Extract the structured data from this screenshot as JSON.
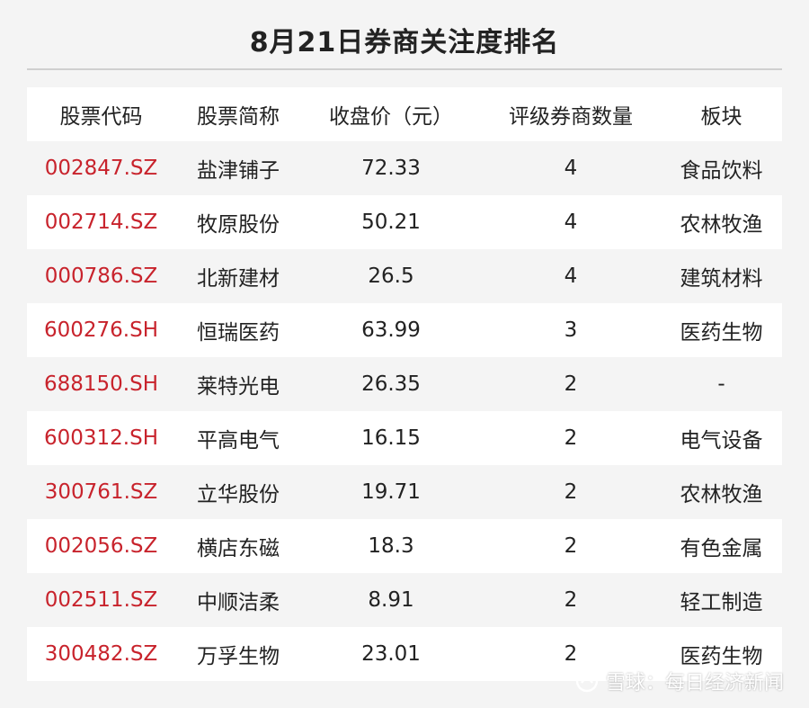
{
  "title": "8月21日券商关注度排名",
  "table": {
    "headers": [
      "股票代码",
      "股票简称",
      "收盘价（元）",
      "评级券商数量",
      "板块"
    ],
    "rows": [
      {
        "code": "002847.SZ",
        "name": "盐津铺子",
        "price": "72.33",
        "brokers": "4",
        "sector": "食品饮料"
      },
      {
        "code": "002714.SZ",
        "name": "牧原股份",
        "price": "50.21",
        "brokers": "4",
        "sector": "农林牧渔"
      },
      {
        "code": "000786.SZ",
        "name": "北新建材",
        "price": "26.5",
        "brokers": "4",
        "sector": "建筑材料"
      },
      {
        "code": "600276.SH",
        "name": "恒瑞医药",
        "price": "63.99",
        "brokers": "3",
        "sector": "医药生物"
      },
      {
        "code": "688150.SH",
        "name": "莱特光电",
        "price": "26.35",
        "brokers": "2",
        "sector": "-"
      },
      {
        "code": "600312.SH",
        "name": "平高电气",
        "price": "16.15",
        "brokers": "2",
        "sector": "电气设备"
      },
      {
        "code": "300761.SZ",
        "name": "立华股份",
        "price": "19.71",
        "brokers": "2",
        "sector": "农林牧渔"
      },
      {
        "code": "002056.SZ",
        "name": "横店东磁",
        "price": "18.3",
        "brokers": "2",
        "sector": "有色金属"
      },
      {
        "code": "002511.SZ",
        "name": "中顺洁柔",
        "price": "8.91",
        "brokers": "2",
        "sector": "轻工制造"
      },
      {
        "code": "300482.SZ",
        "name": "万孚生物",
        "price": "23.01",
        "brokers": "2",
        "sector": "医药生物"
      }
    ]
  },
  "watermark": {
    "text": "每日经济新闻",
    "footer_text": "雪球：每日经济新闻",
    "icon": "snowball-logo-icon"
  },
  "colors": {
    "code_red": "#c8232c",
    "row_white": "#ffffff",
    "row_gray": "#f4f4f4",
    "title": "#222222"
  }
}
